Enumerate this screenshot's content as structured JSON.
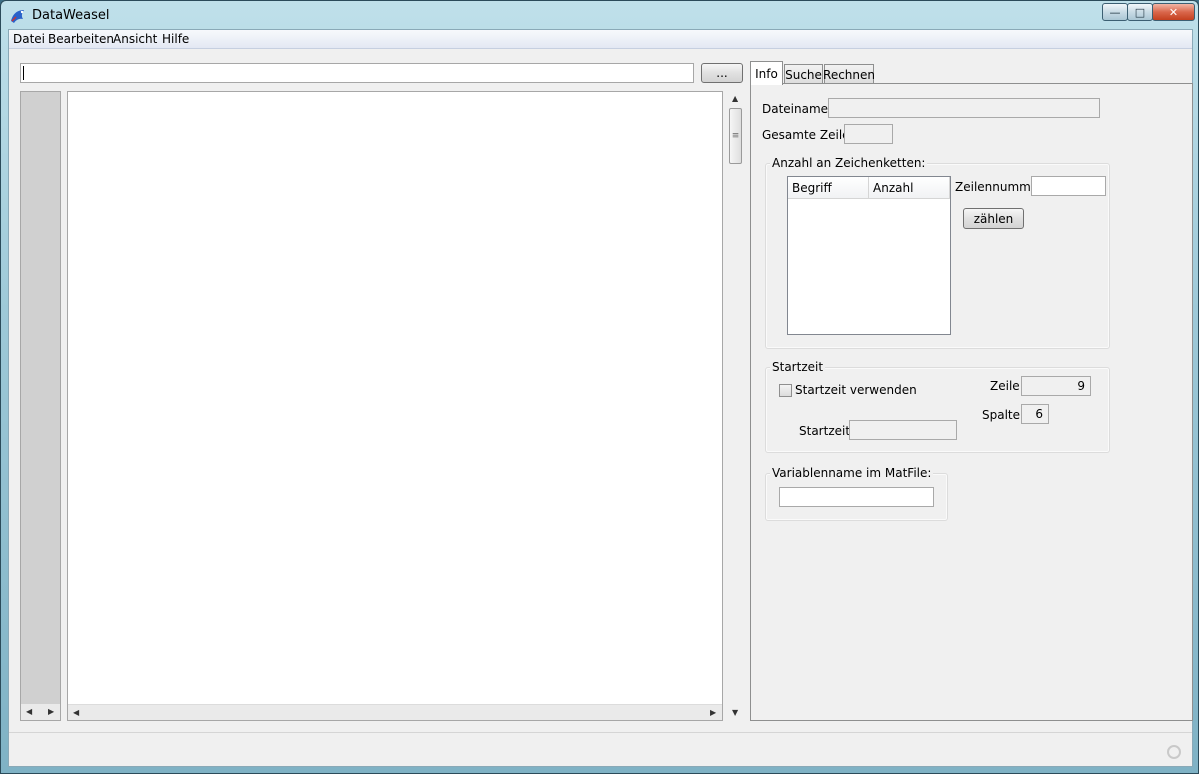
{
  "window": {
    "title": "DataWeasel",
    "controls": {
      "minimize": "—",
      "maximize": "□",
      "close": "✕"
    }
  },
  "menu": [
    "Datei",
    "Bearbeiten",
    "Ansicht",
    "Hilfe"
  ],
  "toolbar": {
    "path_value": "",
    "browse_label": "..."
  },
  "scroll": {
    "up": "▲",
    "down": "▼",
    "left": "◀",
    "right": "▶",
    "thumb_grip": "≡"
  },
  "tabs": [
    "Info",
    "Suche",
    "Rechnen"
  ],
  "info": {
    "dateiname_label": "Dateiname:",
    "dateiname_value": "",
    "gesamte_zeilen_label": "Gesamte Zeilen:",
    "gesamte_zeilen_value": "",
    "anzahl_group": {
      "title": "Anzahl an Zeichenketten:",
      "columns": [
        "Begriff",
        "Anzahl"
      ],
      "zeilennummer_label": "Zeilennummer:",
      "zeilennummer_value": "",
      "count_button": "zählen"
    },
    "startzeit_group": {
      "title": "Startzeit",
      "checkbox_label": "Startzeit verwenden",
      "checked": false,
      "zeile_label": "Zeile:",
      "zeile_value": "9",
      "spalte_label": "Spalte:",
      "spalte_value": "6",
      "startzeit_label": "Startzeit:",
      "startzeit_value": ""
    },
    "variable_group": {
      "title": "Variablenname im MatFile:",
      "value": ""
    }
  }
}
